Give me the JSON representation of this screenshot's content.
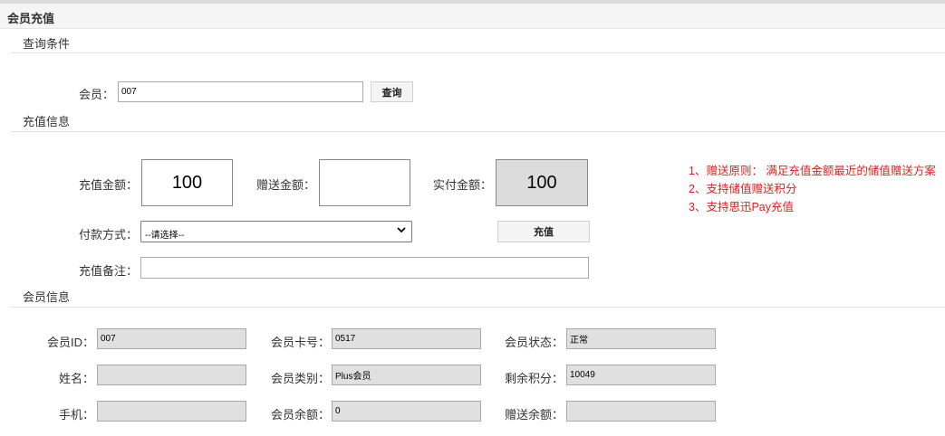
{
  "page": {
    "title": "会员充值"
  },
  "query": {
    "section_title": "查询条件",
    "member_label": "会员：",
    "member_value": "007",
    "search_button": "查询"
  },
  "recharge": {
    "section_title": "充值信息",
    "amount_label": "充值金额：",
    "amount_value": "100",
    "gift_label": "赠送金额：",
    "gift_value": "",
    "actual_label": "实付金额：",
    "actual_value": "100",
    "payment_label": "付款方式：",
    "payment_selected": "--请选择--",
    "submit_button": "充值",
    "remark_label": "充值备注：",
    "remark_value": "",
    "notes": [
      "1、赠送原则： 满足充值金额最近的储值赠送方案",
      "2、支持储值赠送积分",
      "3、支持思迅Pay充值"
    ],
    "note_color": "#e02020"
  },
  "member_info": {
    "section_title": "会员信息",
    "fields": {
      "id": {
        "label": "会员ID：",
        "value": "007"
      },
      "card_no": {
        "label": "会员卡号：",
        "value": "0517"
      },
      "status": {
        "label": "会员状态：",
        "value": "正常"
      },
      "name": {
        "label": "姓名：",
        "value": ""
      },
      "category": {
        "label": "会员类别：",
        "value": "Plus会员"
      },
      "points": {
        "label": "剩余积分：",
        "value": "10049"
      },
      "phone": {
        "label": "手机：",
        "value": ""
      },
      "balance": {
        "label": "会员余额：",
        "value": "0"
      },
      "gift_balance": {
        "label": "赠送余额：",
        "value": ""
      }
    }
  }
}
